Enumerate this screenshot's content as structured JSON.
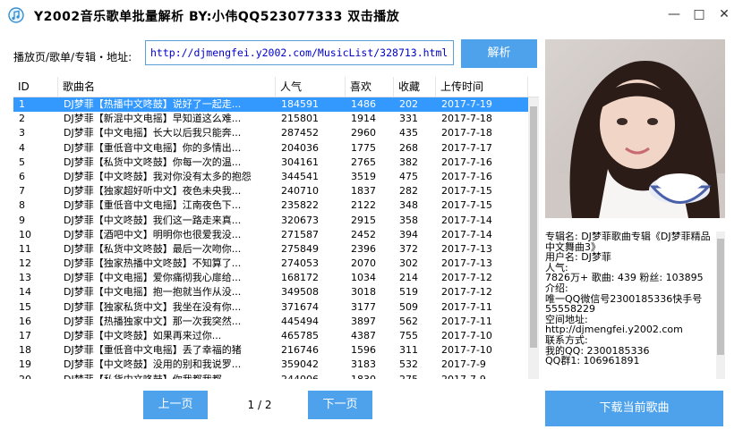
{
  "window": {
    "title": "Y2002音乐歌单批量解析   BY:小伟QQ523077333   双击播放",
    "minimize": "—",
    "maximize": "□",
    "close": "✕"
  },
  "toolbar": {
    "url_label": "播放页/歌单/专辑・地址:",
    "url_value": "http://djmengfei.y2002.com/MusicList/328713.html",
    "parse_label": "解析"
  },
  "table": {
    "columns": [
      "ID",
      "歌曲名",
      "人气",
      "喜欢",
      "收藏",
      "上传时间"
    ],
    "selected_index": 0,
    "rows": [
      [
        "1",
        "DJ梦菲【热播中文咚鼓】说好了一起走...",
        "184591",
        "1486",
        "202",
        "2017-7-19"
      ],
      [
        "2",
        "DJ梦菲【新混中文电摇】早知道这么难...",
        "215801",
        "1914",
        "331",
        "2017-7-18"
      ],
      [
        "3",
        "DJ梦菲【中文电摇】长大以后我只能奔...",
        "287452",
        "2960",
        "435",
        "2017-7-18"
      ],
      [
        "4",
        "DJ梦菲【重低音中文电摇】你的多情出...",
        "204036",
        "1775",
        "268",
        "2017-7-17"
      ],
      [
        "5",
        "DJ梦菲【私货中文咚鼓】你每一次的温...",
        "304161",
        "2765",
        "382",
        "2017-7-16"
      ],
      [
        "6",
        "DJ梦菲【中文咚鼓】我对你没有太多的抱怨",
        "344541",
        "3519",
        "475",
        "2017-7-16"
      ],
      [
        "7",
        "DJ梦菲【独家超好听中文】夜色未央我...",
        "240710",
        "1837",
        "282",
        "2017-7-15"
      ],
      [
        "8",
        "DJ梦菲【重低音中文电摇】江南夜色下...",
        "235822",
        "2122",
        "348",
        "2017-7-15"
      ],
      [
        "9",
        "DJ梦菲【中文咚鼓】我们这一路走来真...",
        "320673",
        "2915",
        "358",
        "2017-7-14"
      ],
      [
        "10",
        "DJ梦菲【酒吧中文】明明你也很爱我没...",
        "271587",
        "2452",
        "394",
        "2017-7-14"
      ],
      [
        "11",
        "DJ梦菲【私货中文咚鼓】最后一次吻你...",
        "275849",
        "2396",
        "372",
        "2017-7-13"
      ],
      [
        "12",
        "DJ梦菲【独家热播中文咚鼓】不知算了...",
        "274053",
        "2070",
        "302",
        "2017-7-13"
      ],
      [
        "13",
        "DJ梦菲【中文电摇】爱你痛彻我心扉给...",
        "168172",
        "1034",
        "214",
        "2017-7-12"
      ],
      [
        "14",
        "DJ梦菲【中文电摇】抱一抱就当作从没...",
        "349508",
        "3018",
        "519",
        "2017-7-12"
      ],
      [
        "15",
        "DJ梦菲【独家私货中文】我坐在没有你...",
        "371674",
        "3177",
        "509",
        "2017-7-11"
      ],
      [
        "16",
        "DJ梦菲【热播独家中文】那一次我突然...",
        "445494",
        "3897",
        "562",
        "2017-7-11"
      ],
      [
        "17",
        "DJ梦菲【中文咚鼓】如果再来过你...",
        "465785",
        "4387",
        "755",
        "2017-7-10"
      ],
      [
        "18",
        "DJ梦菲【重低音中文电摇】丢了幸福的猪",
        "216746",
        "1596",
        "311",
        "2017-7-10"
      ],
      [
        "19",
        "DJ梦菲【中文咚鼓】没用的别和我说罗...",
        "359042",
        "3183",
        "532",
        "2017-7-9"
      ],
      [
        "20",
        "DJ梦菲【私货中文咚鼓】你我都我都...",
        "244006",
        "1830",
        "275",
        "2017-7-9"
      ]
    ]
  },
  "pager": {
    "prev_label": "上一页",
    "indicator": "1 / 2",
    "next_label": "下一页"
  },
  "info": {
    "album": "专辑名: DJ梦菲歌曲专辑《DJ梦菲精品中文舞曲3》",
    "user": "用户名: DJ梦菲",
    "popularity_label": "人气:",
    "stats": "7826万+ 歌曲: 439 粉丝: 103895",
    "intro_label": "介绍:",
    "intro_line1": "唯一QQ微信号2300185336快手号",
    "intro_line2": "55558229",
    "space_label": "空间地址:",
    "space_url": "http://djmengfei.y2002.com",
    "contact_label": "联系方式:",
    "qq": "我的QQ: 2300185336",
    "group": "QQ群1: 106961891"
  },
  "download": {
    "label": "下载当前歌曲"
  },
  "colors": {
    "accent": "#4ea2ec",
    "selection": "#3399ff",
    "url_text": "#0000cc"
  },
  "icons": {
    "app": "music-note-icon"
  }
}
